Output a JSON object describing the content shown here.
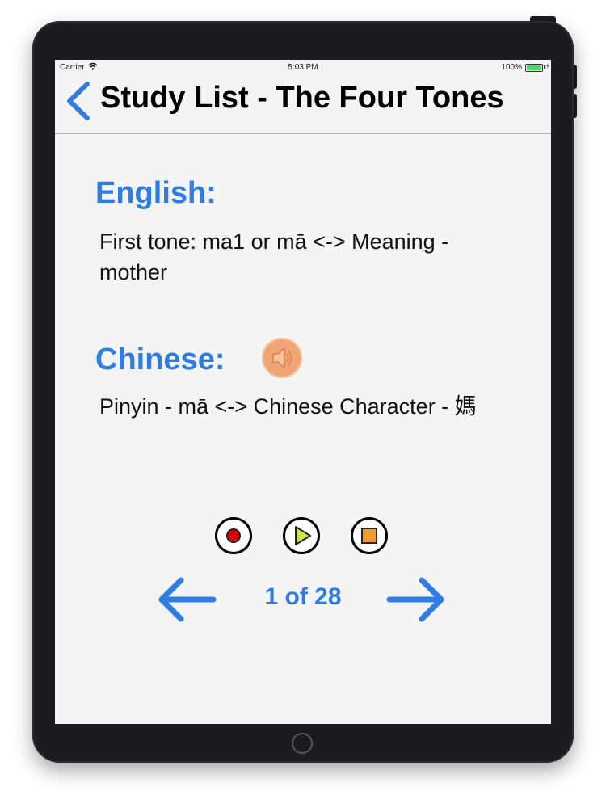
{
  "status_bar": {
    "carrier": "Carrier",
    "time": "5:03 PM",
    "battery": "100%"
  },
  "nav": {
    "title": "Study List - The Four Tones",
    "back_icon": "chevron-left-icon"
  },
  "english": {
    "label": "English:",
    "text": "First tone: ma1 or mā <-> Meaning - mother"
  },
  "chinese": {
    "label": "Chinese:",
    "text": "Pinyin - mā <-> Chinese Character - 媽",
    "sound_icon": "speaker-icon"
  },
  "controls": {
    "record_icon": "record-icon",
    "play_icon": "play-icon",
    "stop_icon": "stop-icon"
  },
  "pagination": {
    "counter": "1 of 28",
    "prev_icon": "arrow-left-icon",
    "next_icon": "arrow-right-icon"
  },
  "colors": {
    "accent": "#2f7de1",
    "sound_button": "#f0a576",
    "record": "#d60000",
    "play": "#c8e84a",
    "stop": "#f29a2e"
  }
}
